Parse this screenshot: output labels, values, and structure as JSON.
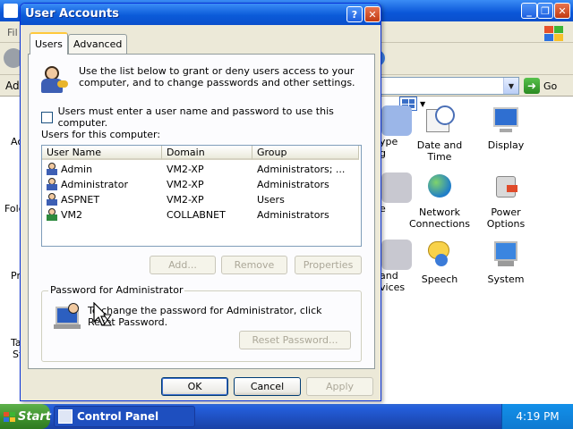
{
  "background_window": {
    "title_fragment": "",
    "menu_fragment": "Fil",
    "address_fragment": "Ad",
    "go_label": "Go",
    "left_fragments": [
      "Ac",
      "Fold",
      "Pr",
      "Ta",
      "St"
    ],
    "items": [
      {
        "label": "ype\ng",
        "icon": "date-fragment-icon"
      },
      {
        "label": "Date and Time",
        "icon": "clock-calendar-icon"
      },
      {
        "label": "Display",
        "icon": "monitor-icon"
      },
      {
        "label": "e",
        "icon": "fragment-icon"
      },
      {
        "label": "Network Connections",
        "icon": "globe-network-icon"
      },
      {
        "label": "Power Options",
        "icon": "power-plug-icon"
      },
      {
        "label": "and\nvices",
        "icon": "fragment-icon"
      },
      {
        "label": "Speech",
        "icon": "speech-icon"
      },
      {
        "label": "System",
        "icon": "system-icon"
      }
    ]
  },
  "dialog": {
    "title": "User Accounts",
    "help_label": "?",
    "close_label": "✕",
    "tabs": [
      {
        "label": "Users",
        "active": true
      },
      {
        "label": "Advanced",
        "active": false
      }
    ],
    "intro_text": "Use the list below to grant or deny users access to your computer, and to change passwords and other settings.",
    "must_enter_label": "Users must enter a user name and password to use this computer.",
    "must_enter_checked": false,
    "users_label": "Users for this computer:",
    "columns": [
      "User Name",
      "Domain",
      "Group"
    ],
    "users": [
      {
        "name": "Admin",
        "domain": "VM2-XP",
        "group": "Administrators; ..."
      },
      {
        "name": "Administrator",
        "domain": "VM2-XP",
        "group": "Administrators"
      },
      {
        "name": "ASPNET",
        "domain": "VM2-XP",
        "group": "Users"
      },
      {
        "name": "VM2",
        "domain": "COLLABNET",
        "group": "Administrators"
      }
    ],
    "add_label": "Add...",
    "remove_label": "Remove",
    "properties_label": "Properties",
    "password_group_label": "Password for Administrator",
    "password_text": "To change the password for Administrator, click Reset Password.",
    "reset_label": "Reset Password...",
    "ok_label": "OK",
    "cancel_label": "Cancel",
    "apply_label": "Apply"
  },
  "taskbar": {
    "start_label": "Start",
    "task_label": "Control Panel",
    "clock": "4:19 PM"
  },
  "colors": {
    "xp_blue": "#0a4fcc",
    "dialog_face": "#ece9d8",
    "tab_highlight": "#ffc83c",
    "start_green": "#3c8f2b"
  }
}
